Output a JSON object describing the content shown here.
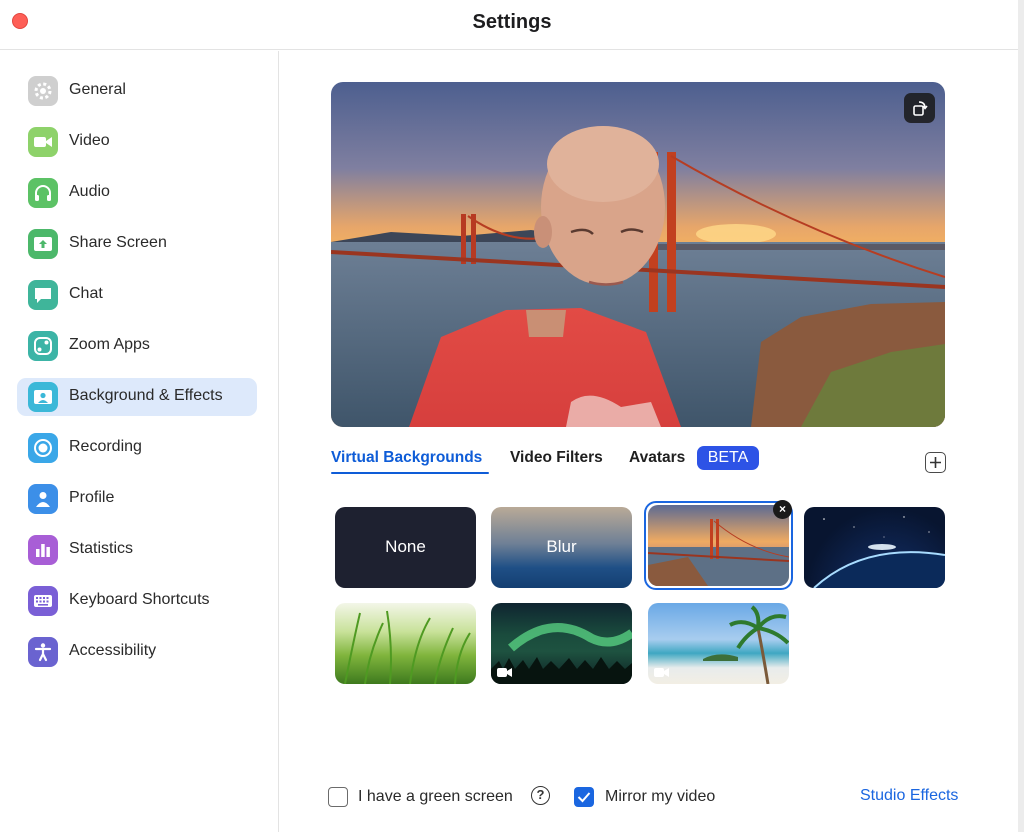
{
  "window": {
    "title": "Settings"
  },
  "sidebar": {
    "items": [
      {
        "label": "General",
        "icon": "gear-icon",
        "color": "#c9c9c9"
      },
      {
        "label": "Video",
        "icon": "video-camera-icon",
        "color": "#8ed26a"
      },
      {
        "label": "Audio",
        "icon": "headphones-icon",
        "color": "#5cc265"
      },
      {
        "label": "Share Screen",
        "icon": "share-screen-icon",
        "color": "#4cb86a"
      },
      {
        "label": "Chat",
        "icon": "chat-bubble-icon",
        "color": "#3fb59a"
      },
      {
        "label": "Zoom Apps",
        "icon": "zoom-apps-icon",
        "color": "#3cb4a6"
      },
      {
        "label": "Background & Effects",
        "icon": "background-person-icon",
        "color": "#3bb8d8"
      },
      {
        "label": "Recording",
        "icon": "record-icon",
        "color": "#3aa7e8"
      },
      {
        "label": "Profile",
        "icon": "person-icon",
        "color": "#3c8fe8"
      },
      {
        "label": "Statistics",
        "icon": "bar-chart-icon",
        "color": "#a85ed6"
      },
      {
        "label": "Keyboard Shortcuts",
        "icon": "keyboard-icon",
        "color": "#7a5fd6"
      },
      {
        "label": "Accessibility",
        "icon": "accessibility-icon",
        "color": "#6a63d0"
      }
    ],
    "active_index": 6
  },
  "tabs": {
    "items": [
      "Virtual Backgrounds",
      "Video Filters",
      "Avatars"
    ],
    "beta_badge": "BETA",
    "active": "Virtual Backgrounds"
  },
  "backgrounds": {
    "none_label": "None",
    "blur_label": "Blur",
    "items": [
      {
        "name": "None"
      },
      {
        "name": "Blur"
      },
      {
        "name": "golden-gate-bridge",
        "selected": true
      },
      {
        "name": "earth-from-space"
      },
      {
        "name": "grass"
      },
      {
        "name": "northern-lights",
        "video": true
      },
      {
        "name": "beach-palm-tree",
        "video": true
      }
    ]
  },
  "footer": {
    "green_screen_label": "I have a green screen",
    "green_screen_checked": false,
    "mirror_label": "Mirror my video",
    "mirror_checked": true,
    "studio_effects_label": "Studio Effects",
    "help_glyph": "?"
  },
  "colors": {
    "accent": "#1a66e0",
    "active_nav_bg": "#dde9fb",
    "beta_bg": "#2d53e6"
  }
}
